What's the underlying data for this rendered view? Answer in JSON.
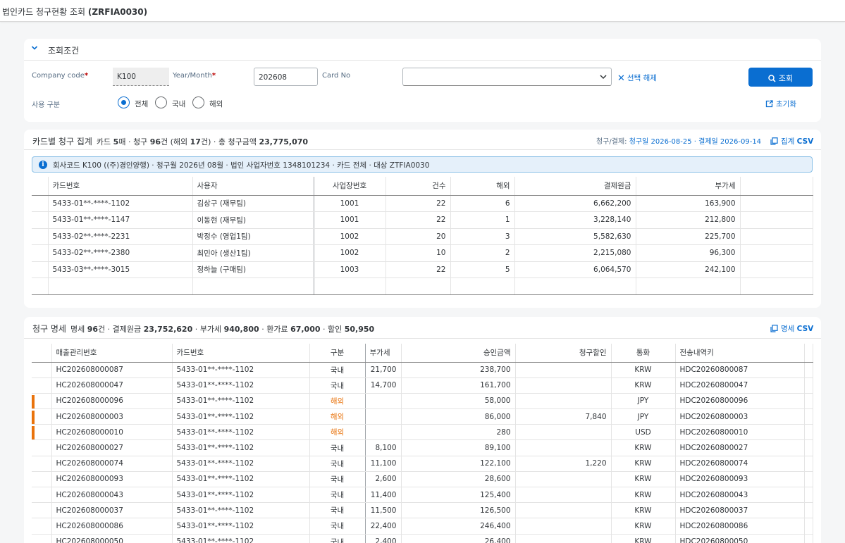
{
  "app": {
    "title_prefix": "법인카드 청구현황 조회 ",
    "title_code": "(ZRFIA0030)"
  },
  "filter": {
    "title": "조회조건",
    "company_code_label": "Company code",
    "company_code_value": "K100",
    "year_month_label": "Year/Month",
    "year_month_value": "202608",
    "card_no_label": "Card No",
    "card_no_value": "",
    "required_mark": "*",
    "clear_label": "선택 해제",
    "search_label": "조회",
    "usage_label": "사용 구분",
    "usage_options": [
      "전체",
      "국내",
      "해외"
    ],
    "usage_selected": "전체",
    "reset_label": "초기화"
  },
  "summary": {
    "title": "카드별 청구 집계",
    "stats_cards_prefix": "카드 ",
    "stats_cards": "5",
    "stats_cards_suffix": "매 · 청구 ",
    "stats_claims": "96",
    "stats_claims_suffix": "건 (해외 ",
    "stats_overseas": "17",
    "stats_total_prefix": "건) · 총 청구금액 ",
    "stats_total": "23,775,070",
    "period_prefix": "청구/결제: ",
    "period_value": "청구일 2026-08-25 · 결제일 2026-09-14",
    "csv_prefix": "집계 ",
    "csv_label": "CSV",
    "info": "회사코드 K100 ((주)경인양행) · 청구월 2026년 08월 · 법인 사업자번호 1348101234 · 카드 전체 · 대상 ZTFIA0030",
    "columns": [
      "카드번호",
      "사용자",
      "사업장번호",
      "건수",
      "해외",
      "결제원금",
      "부가세"
    ],
    "rows": [
      [
        "5433-01**-****-1102",
        "김상구 (재무팀)",
        "1001",
        "22",
        "6",
        "6,662,200",
        "163,900"
      ],
      [
        "5433-01**-****-1147",
        "이동현 (재무팀)",
        "1001",
        "22",
        "1",
        "3,228,140",
        "212,800"
      ],
      [
        "5433-02**-****-2231",
        "박정수 (영업1팀)",
        "1002",
        "20",
        "3",
        "5,582,630",
        "225,700"
      ],
      [
        "5433-02**-****-2380",
        "최민아 (생산1팀)",
        "1002",
        "10",
        "2",
        "2,215,080",
        "96,300"
      ],
      [
        "5433-03**-****-3015",
        "정하늘 (구매팀)",
        "1003",
        "22",
        "5",
        "6,064,570",
        "242,100"
      ]
    ]
  },
  "detail": {
    "title": "청구 명세",
    "s1": "명세 ",
    "count": "96",
    "s2": "건 · 결제원금 ",
    "principal": "23,752,620",
    "s3": " · 부가세 ",
    "vat": "940,800",
    "s4": " · 환가료 ",
    "fee": "67,000",
    "s5": " · 할인 ",
    "discount": "50,950",
    "csv_prefix": "명세 ",
    "csv_label": "CSV",
    "columns": [
      "매출관리번호",
      "카드번호",
      "구분",
      "부가세",
      "승인금액",
      "청구할인",
      "통화",
      "전송내역키"
    ],
    "rows": [
      {
        "flag": false,
        "cells": [
          "HC202608000087",
          "5433-01**-****-1102",
          "국내",
          "21,700",
          "238,700",
          "",
          "KRW",
          "HDC20260800087"
        ]
      },
      {
        "flag": false,
        "cells": [
          "HC202608000047",
          "5433-01**-****-1102",
          "국내",
          "14,700",
          "161,700",
          "",
          "KRW",
          "HDC20260800047"
        ]
      },
      {
        "flag": true,
        "cells": [
          "HC202608000096",
          "5433-01**-****-1102",
          "해외",
          "",
          "58,000",
          "",
          "JPY",
          "HDC20260800096"
        ]
      },
      {
        "flag": true,
        "cells": [
          "HC202608000003",
          "5433-01**-****-1102",
          "해외",
          "",
          "86,000",
          "7,840",
          "JPY",
          "HDC20260800003"
        ]
      },
      {
        "flag": true,
        "cells": [
          "HC202608000010",
          "5433-01**-****-1102",
          "해외",
          "",
          "280",
          "",
          "USD",
          "HDC20260800010"
        ]
      },
      {
        "flag": false,
        "cells": [
          "HC202608000027",
          "5433-01**-****-1102",
          "국내",
          "8,100",
          "89,100",
          "",
          "KRW",
          "HDC20260800027"
        ]
      },
      {
        "flag": false,
        "cells": [
          "HC202608000074",
          "5433-01**-****-1102",
          "국내",
          "11,100",
          "122,100",
          "1,220",
          "KRW",
          "HDC20260800074"
        ]
      },
      {
        "flag": false,
        "cells": [
          "HC202608000093",
          "5433-01**-****-1102",
          "국내",
          "2,600",
          "28,600",
          "",
          "KRW",
          "HDC20260800093"
        ]
      },
      {
        "flag": false,
        "cells": [
          "HC202608000043",
          "5433-01**-****-1102",
          "국내",
          "11,400",
          "125,400",
          "",
          "KRW",
          "HDC20260800043"
        ]
      },
      {
        "flag": false,
        "cells": [
          "HC202608000037",
          "5433-01**-****-1102",
          "국내",
          "11,500",
          "126,500",
          "",
          "KRW",
          "HDC20260800037"
        ]
      },
      {
        "flag": false,
        "cells": [
          "HC202608000086",
          "5433-01**-****-1102",
          "국내",
          "22,400",
          "246,400",
          "",
          "KRW",
          "HDC20260800086"
        ]
      },
      {
        "flag": false,
        "cells": [
          "HC202608000050",
          "5433-01**-****-1102",
          "국내",
          "2,400",
          "26,400",
          "",
          "KRW",
          "HDC20260800050"
        ]
      }
    ]
  },
  "colors": {
    "accent": "#0a6ed1",
    "overseas": "#e9730c",
    "background": "#f5f6f7"
  },
  "icons": [
    "chevron-down-icon",
    "close-icon",
    "search-icon",
    "reset-icon",
    "copy-icon",
    "info-icon"
  ]
}
